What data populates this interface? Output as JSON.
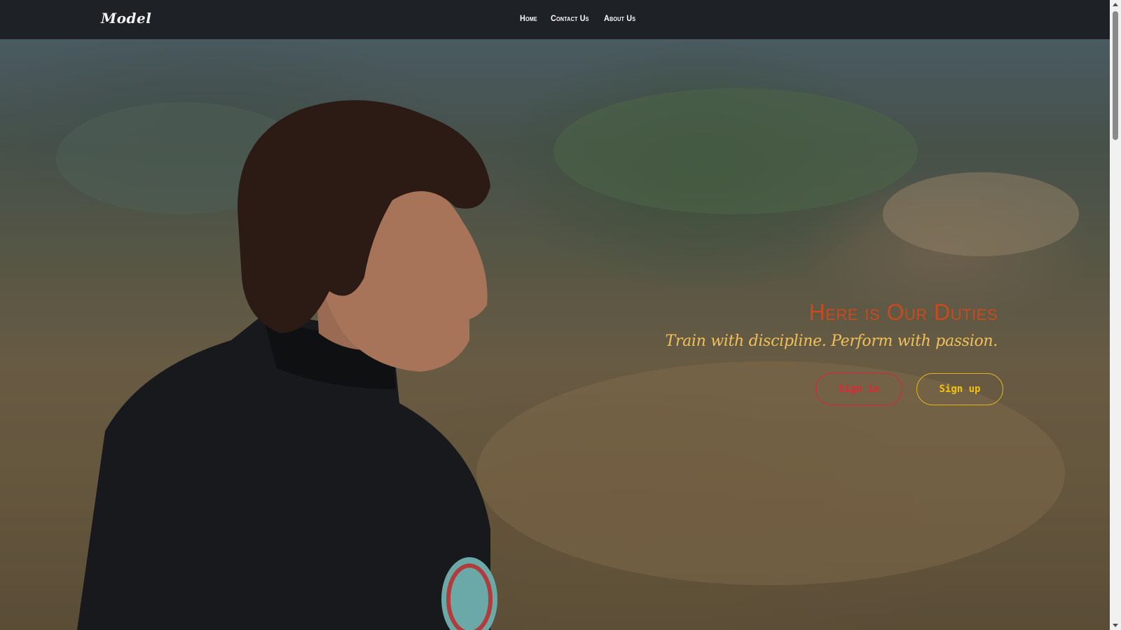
{
  "navbar": {
    "brand": "Model",
    "links": [
      "Home",
      "Contact Us",
      "About Us"
    ]
  },
  "hero": {
    "title": "Here is Our Duties",
    "subtitle": "Train with discipline. Perform with passion.",
    "signin_label": "Sign in",
    "signup_label": "Sign up",
    "background_image": "young man in black jacket looking over shoulder, outdoor brush landscape"
  },
  "colors": {
    "navbar_bg": "#1e2226",
    "title": "#c84a1e",
    "subtitle": "#f0c15a",
    "signin": "#e32636",
    "signup": "#f2c20d"
  }
}
